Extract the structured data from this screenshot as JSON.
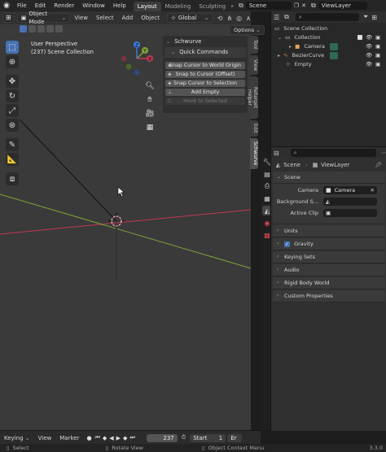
{
  "topbar": {
    "menus": [
      "File",
      "Edit",
      "Render",
      "Window",
      "Help"
    ],
    "workspaces": [
      "Layout",
      "Modeling",
      "Sculpting"
    ],
    "scene": "Scene",
    "view_layer": "ViewLayer"
  },
  "viewport": {
    "mode": "Object Mode",
    "menus": [
      "View",
      "Select",
      "Add",
      "Object"
    ],
    "transform_orientation": "Global",
    "options": "Options",
    "info_line1": "User Perspective",
    "info_line2": "(237) Scene Collection",
    "gizmo_labels": {
      "x": "X",
      "y": "Y",
      "z": "Z"
    }
  },
  "npanel": {
    "title": "Schwurve",
    "section": "Quick Commands",
    "buttons": [
      {
        "label": "Snap Cursor to World Origin",
        "enabled": true
      },
      {
        "label": "Snap to Cursor (Offset)",
        "enabled": true
      },
      {
        "label": "Snap Cursor to Selection",
        "enabled": true
      },
      {
        "label": "Add Empty",
        "enabled": true
      },
      {
        "label": "Hook to Selected",
        "enabled": false
      }
    ],
    "tabs": [
      {
        "label": "Tool",
        "active": false
      },
      {
        "label": "View",
        "active": false
      },
      {
        "label": "Retarget Helper",
        "active": false
      },
      {
        "label": "Edit",
        "active": false
      },
      {
        "label": "Schwurve",
        "active": true
      }
    ]
  },
  "outliner": {
    "root": "Scene Collection",
    "items": [
      {
        "label": "Collection",
        "depth": 1,
        "icon": "collection-icon"
      },
      {
        "label": "Camera",
        "depth": 2,
        "icon": "camera-icon"
      },
      {
        "label": "BezierCurve",
        "depth": 1,
        "icon": "curve-icon"
      },
      {
        "label": "Empty",
        "depth": 1,
        "icon": "empty-icon"
      }
    ]
  },
  "properties": {
    "breadcrumb_scene": "Scene",
    "breadcrumb_layer": "ViewLayer",
    "scene_panel": "Scene",
    "camera_label": "Camera",
    "camera_value": "Camera",
    "background_label": "Background S...",
    "active_clip_label": "Active Clip",
    "panels": [
      "Units",
      "Gravity",
      "Keying Sets",
      "Audio",
      "Rigid Body World",
      "Custom Properties"
    ],
    "gravity_checked": true
  },
  "timeline": {
    "keying": "Keying",
    "view": "View",
    "marker": "Marker",
    "current_frame": "237",
    "start_label": "Start",
    "start_value": "1",
    "end_label": "Er"
  },
  "statusbar": {
    "select": "Select",
    "rotate": "Rotate View",
    "context": "Object Context Menu",
    "version": "3.3.0"
  },
  "colors": {
    "accent": "#4772b3",
    "x_axis": "#c0394f",
    "y_axis": "#7ea43a"
  }
}
